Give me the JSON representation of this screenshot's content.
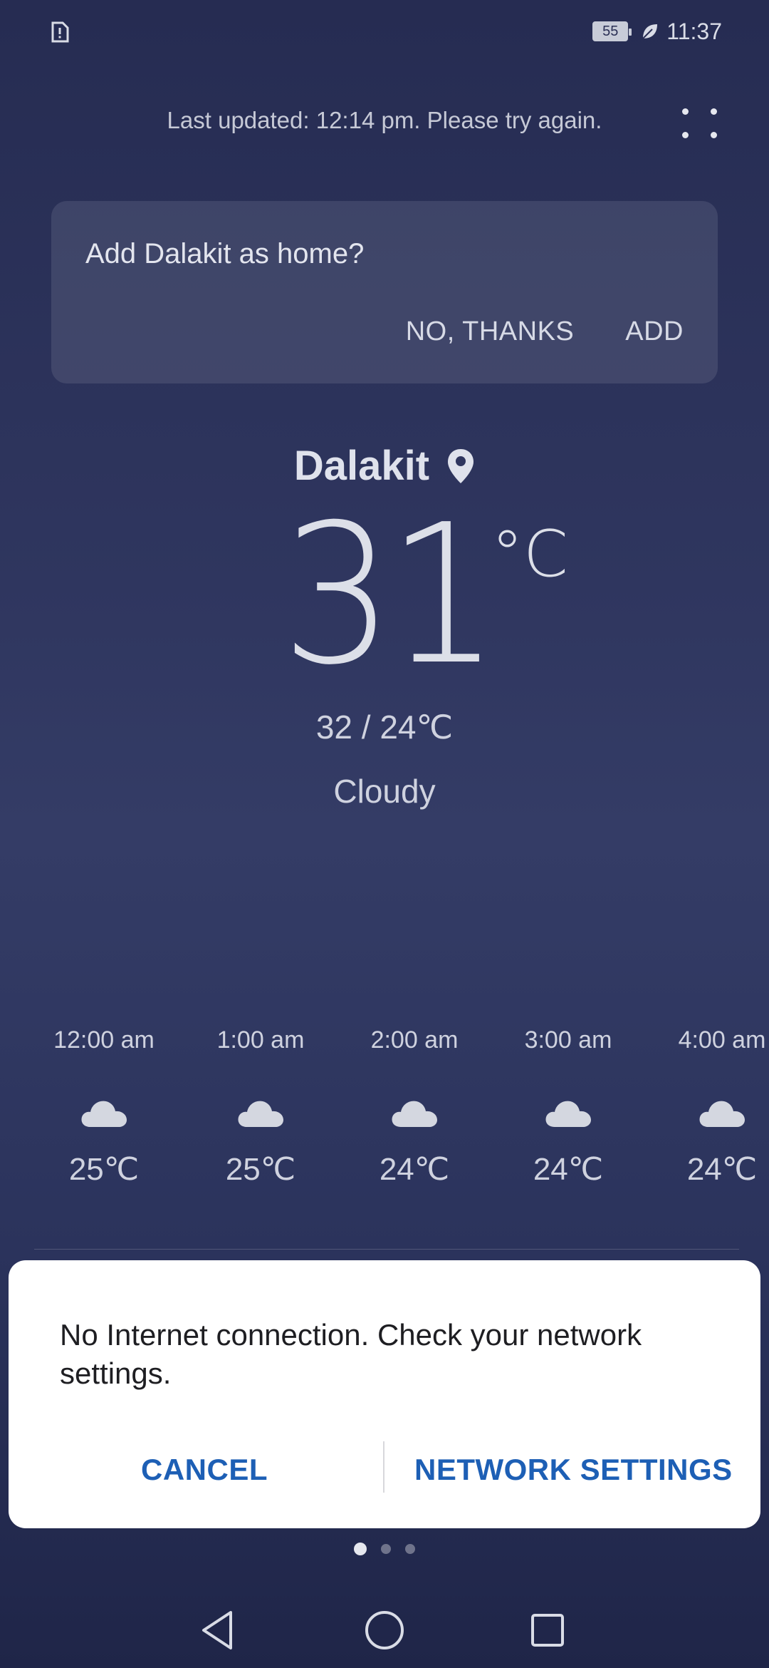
{
  "status_bar": {
    "left_icon": "sim-alert-icon",
    "battery": "55",
    "eco_icon": "leaf-icon",
    "time": "11:37"
  },
  "header": {
    "last_updated": "Last updated: 12:14 pm. Please try again.",
    "more_icon": "more-dots-icon"
  },
  "home_card": {
    "title": "Add Dalakit as home?",
    "no_thanks_label": "NO, THANKS",
    "add_label": "ADD"
  },
  "current": {
    "location": "Dalakit",
    "location_icon": "location-pin-icon",
    "temperature": "31",
    "unit": "°C",
    "range": "32 / 24℃",
    "condition": "Cloudy"
  },
  "hourly": [
    {
      "time": "12:00 am",
      "icon": "cloud-icon",
      "temp": "25℃"
    },
    {
      "time": "1:00 am",
      "icon": "cloud-icon",
      "temp": "25℃"
    },
    {
      "time": "2:00 am",
      "icon": "cloud-icon",
      "temp": "24℃"
    },
    {
      "time": "3:00 am",
      "icon": "cloud-icon",
      "temp": "24℃"
    },
    {
      "time": "4:00 am",
      "icon": "cloud-icon",
      "temp": "24℃"
    }
  ],
  "dialog": {
    "message": "No Internet connection. Check your network settings.",
    "cancel_label": "CANCEL",
    "settings_label": "NETWORK SETTINGS"
  },
  "pager": {
    "count": 3,
    "active_index": 0
  },
  "navbar": {
    "back_icon": "back-triangle-icon",
    "home_icon": "home-circle-icon",
    "recents_icon": "recents-square-icon"
  },
  "colors": {
    "accent": "#1d5fb5",
    "background_top": "#262c52",
    "background_bottom": "#1f2548",
    "dialog_bg": "#ffffff"
  }
}
